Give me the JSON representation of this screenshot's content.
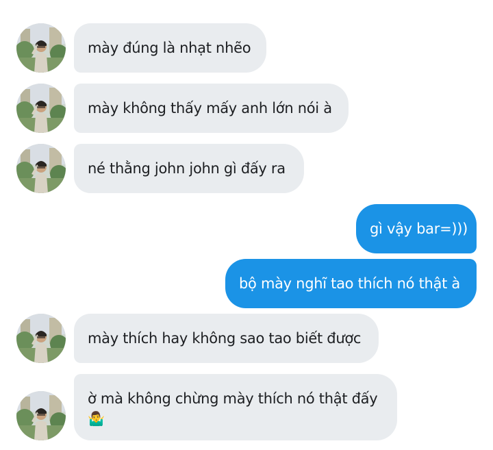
{
  "messages": [
    {
      "side": "incoming",
      "text": "mày đúng là nhạt nhẽo"
    },
    {
      "side": "incoming",
      "text": "mày không thấy mấy anh lớn nói à"
    },
    {
      "side": "incoming",
      "text": "né thằng john john gì đấy ra"
    },
    {
      "side": "outgoing",
      "text": "gì vậy bar=)))"
    },
    {
      "side": "outgoing",
      "text": "bộ mày nghĩ tao thích nó thật à"
    },
    {
      "side": "incoming",
      "text": "mày thích hay không sao tao biết được"
    },
    {
      "side": "incoming",
      "text": "ờ mà không chừng mày thích nó thật đấy",
      "emoji": "🤷‍♂️"
    }
  ],
  "avatar_icon": "user-photo-icon",
  "colors": {
    "incoming_bubble": "#e9ecef",
    "outgoing_bubble": "#1b93e6",
    "incoming_text": "#1c1e21",
    "outgoing_text": "#ffffff"
  }
}
